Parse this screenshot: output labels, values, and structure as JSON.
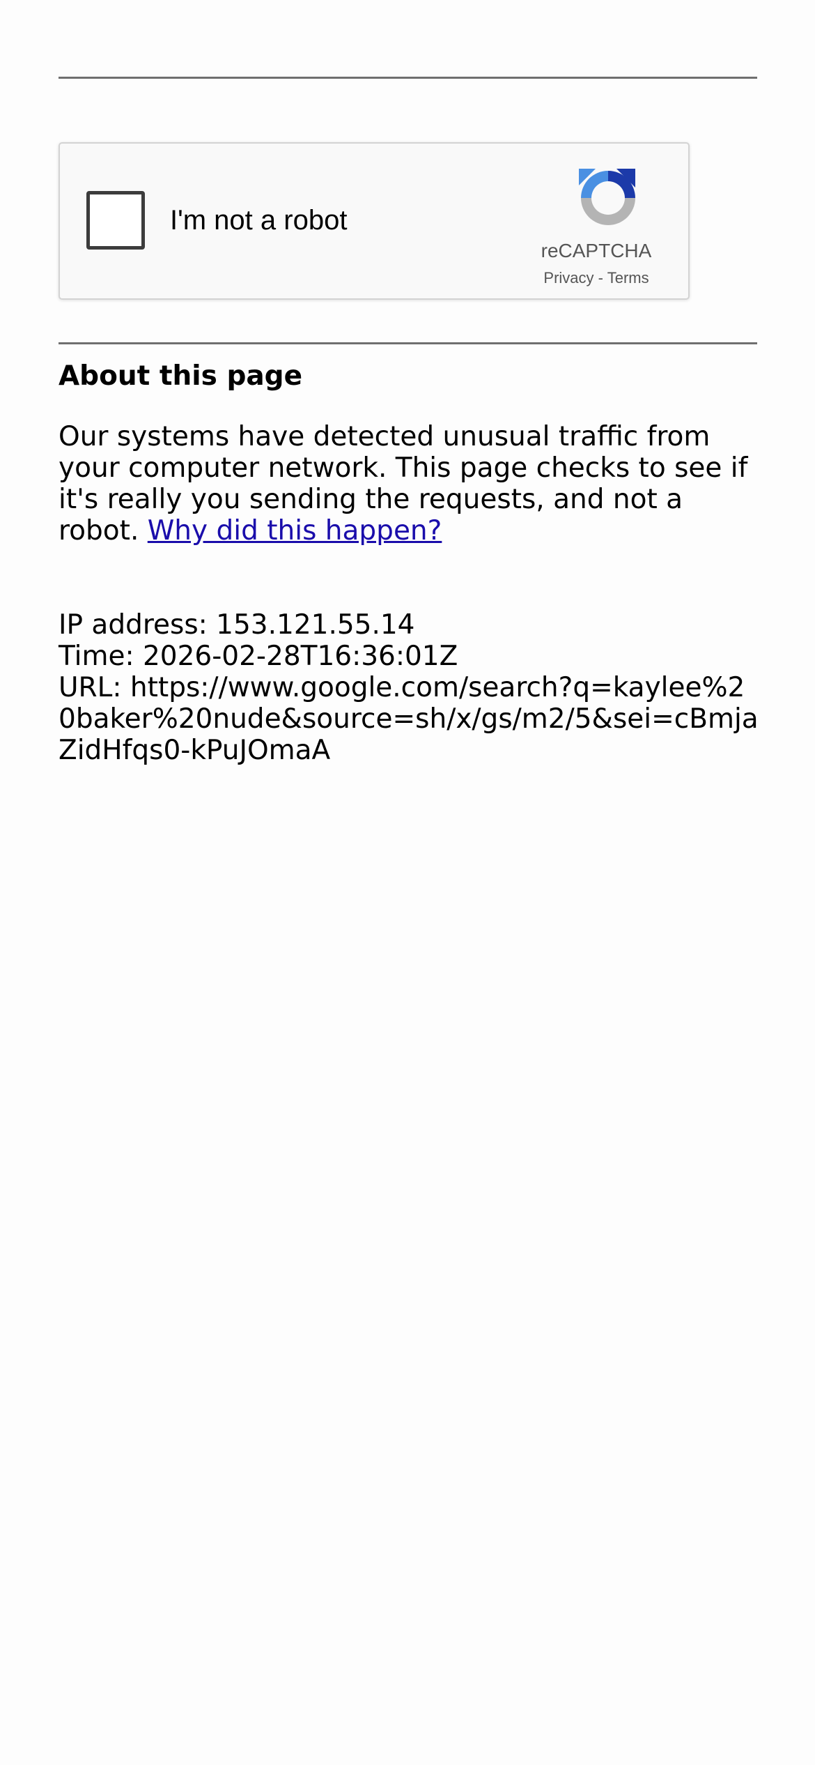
{
  "captcha": {
    "checkbox_label": "I'm not a robot",
    "brand": "reCAPTCHA",
    "privacy_label": "Privacy",
    "separator": "-",
    "terms_label": "Terms",
    "logo_icon": "recaptcha-logo-icon",
    "colors": {
      "logo_blue_light": "#4a90e2",
      "logo_blue_dark": "#1c3aa9",
      "logo_gray": "#b4b4b4"
    }
  },
  "about": {
    "title": "About this page",
    "body_text": "Our systems have detected unusual traffic from your computer network. This page checks to see if it's really you sending the requests, and not a robot.",
    "link_text": "Why did this happen?"
  },
  "info": {
    "ip_line": "IP address: 153.121.55.14",
    "time_line": "Time: 2026-02-28T16:36:01Z",
    "url_line": "URL: https://www.google.com/search?q=kaylee%20baker%20nude&source=sh/x/gs/m2/5&sei=cBmjaZidHfqs0-kPuJOmaA"
  },
  "colors": {
    "link": "#1a0dab",
    "rule": "#6f6f6f",
    "captcha_background": "#f9f9f9"
  }
}
